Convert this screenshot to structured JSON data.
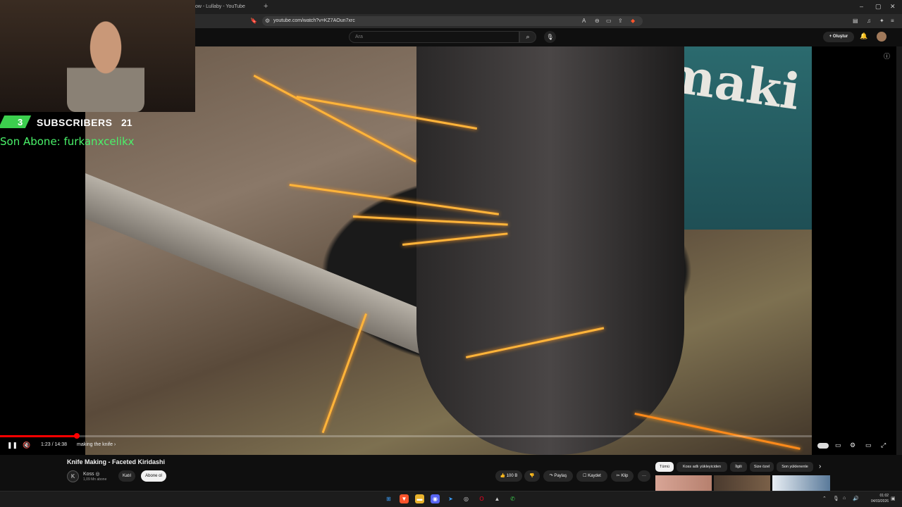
{
  "browser": {
    "tab_title": "ow - Lullaby - YouTube",
    "new_tab": "+",
    "url": "youtube.com/watch?v=KZ7AOun7xrc",
    "window_controls": [
      "–",
      "▢",
      "✕"
    ]
  },
  "header": {
    "search_placeholder": "Ara",
    "create_label": "+ Oluştur"
  },
  "video": {
    "brand_text": "maki"
  },
  "overlay": {
    "subs_badge": "3",
    "subs_label": "SUBSCRIBERS",
    "subs_count": "21",
    "last_sub": "Son Abone: furkanxcelikx"
  },
  "player": {
    "time": "1:23 / 14:38",
    "chapter": "making the knife ›",
    "progress_fraction": 0.095
  },
  "details": {
    "title": "Knife Making - Faceted Kiridashi",
    "channel_initial": "K",
    "channel_name": "Koss ◎",
    "channel_subs": "1,09 Mn abone",
    "join_label": "Katıl",
    "subscribe_label": "Abone ol",
    "like_label": "👍 100 B",
    "dislike_label": "👎",
    "share_label": "↷ Paylaş",
    "save_label": "☐ Kaydet",
    "clip_label": "✂ Klip",
    "more_label": "···"
  },
  "chips": [
    "Tümü",
    "Koss adlı yükleyiciden",
    "İlgili",
    "Size özel",
    "Son yüklenenle"
  ],
  "chips_next": "›",
  "taskbar": {
    "time": "01:02",
    "date": "04/03/2026"
  },
  "colors": {
    "accent": "#ff0000",
    "overlay_green": "#4af26a",
    "badge_green": "#3ccf4e"
  }
}
